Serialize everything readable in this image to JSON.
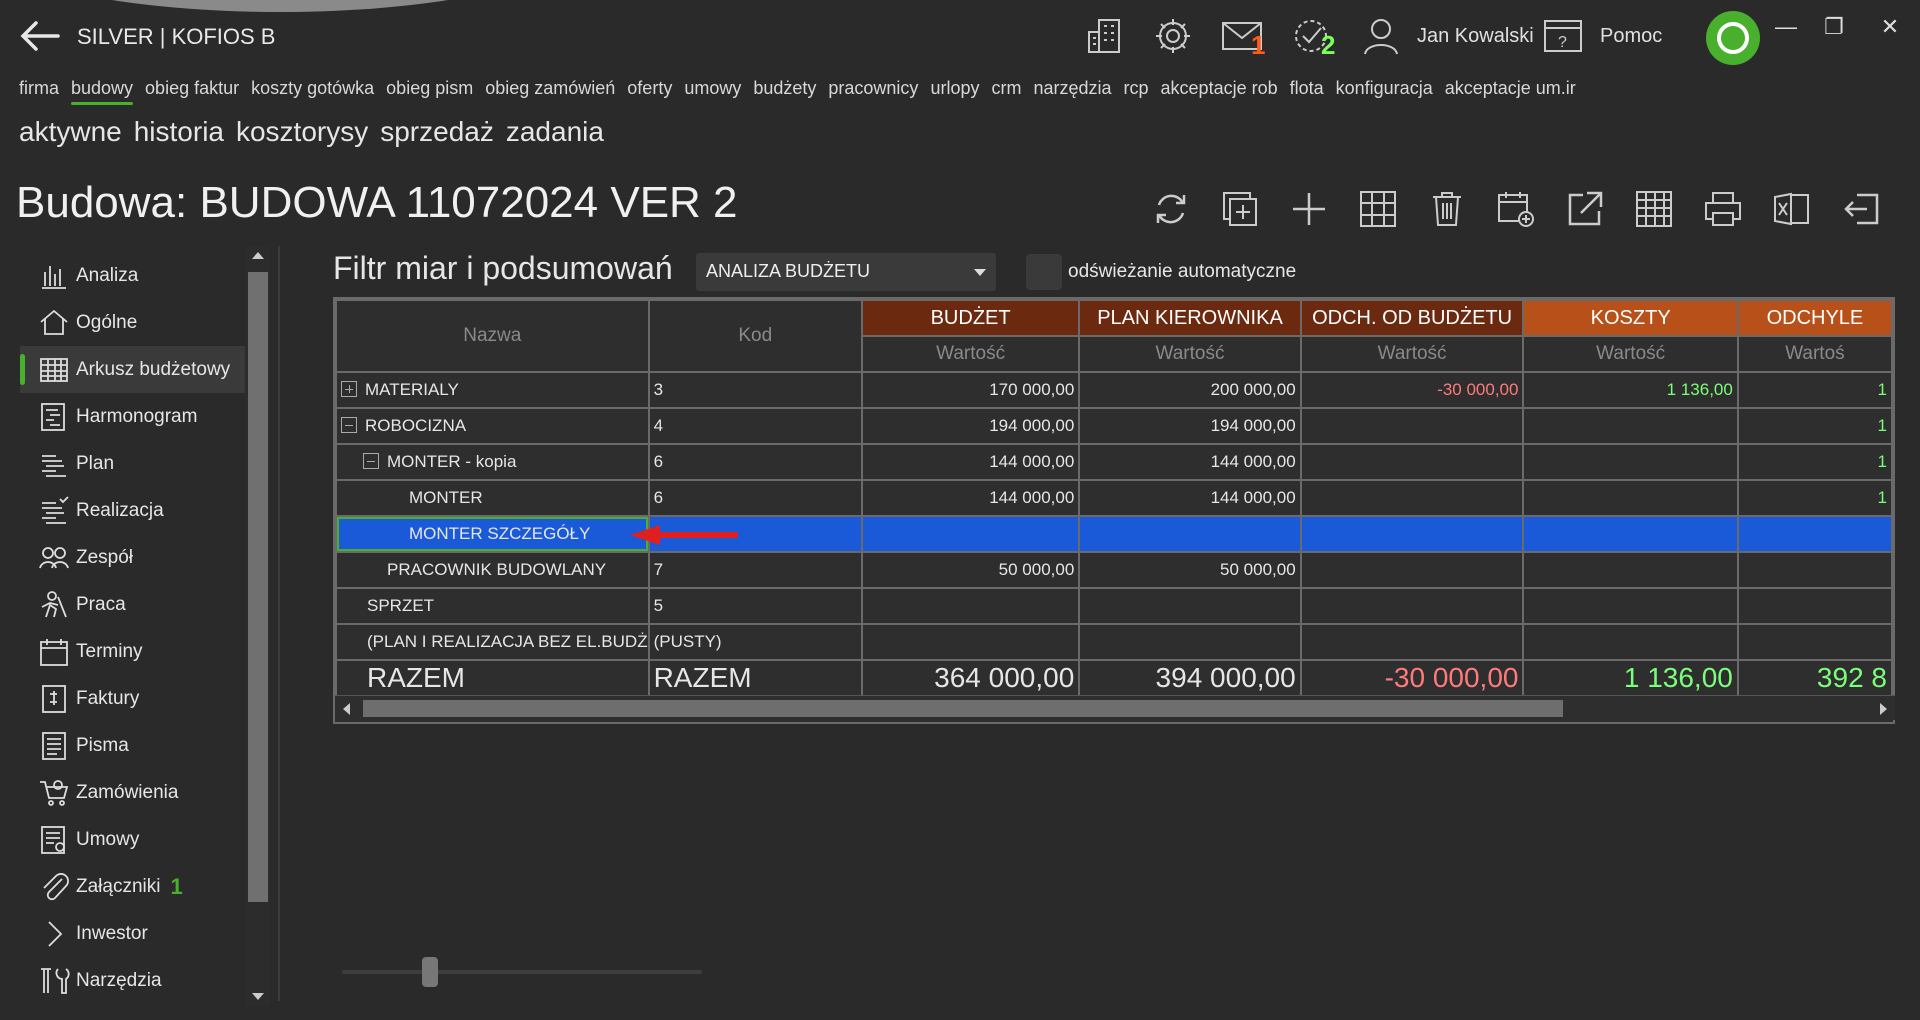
{
  "app": {
    "title": "SILVER | KOFIOS B"
  },
  "header": {
    "mail_badge": "1",
    "tasks_badge": "2",
    "user_name": "Jan Kowalski",
    "help_label": "Pomoc"
  },
  "menu_main": [
    "firma",
    "budowy",
    "obieg faktur",
    "koszty gotówka",
    "obieg pism",
    "obieg zamówień",
    "oferty",
    "umowy",
    "budżety",
    "pracownicy",
    "urlopy",
    "crm",
    "narzędzia",
    "rcp",
    "akceptacje rob",
    "flota",
    "konfiguracja",
    "akceptacje um.ir"
  ],
  "menu_main_active": "budowy",
  "menu_sub": [
    "aktywne",
    "historia",
    "kosztorysy",
    "sprzedaż",
    "zadania"
  ],
  "page_title": "Budowa: BUDOWA 11072024 VER 2",
  "sidebar": [
    {
      "label": "Analiza",
      "icon": "bar-chart-icon"
    },
    {
      "label": "Ogólne",
      "icon": "home-icon"
    },
    {
      "label": "Arkusz budżetowy",
      "icon": "table-icon",
      "active": true
    },
    {
      "label": "Harmonogram",
      "icon": "schedule-icon"
    },
    {
      "label": "Plan",
      "icon": "list-icon"
    },
    {
      "label": "Realizacja",
      "icon": "list-check-icon"
    },
    {
      "label": "Zespół",
      "icon": "team-icon"
    },
    {
      "label": "Praca",
      "icon": "worker-icon"
    },
    {
      "label": "Terminy",
      "icon": "calendar-icon"
    },
    {
      "label": "Faktury",
      "icon": "invoice-icon"
    },
    {
      "label": "Pisma",
      "icon": "document-icon"
    },
    {
      "label": "Zamówienia",
      "icon": "cart-icon"
    },
    {
      "label": "Umowy",
      "icon": "contract-icon"
    },
    {
      "label": "Załączniki",
      "icon": "paperclip-icon",
      "badge": "1"
    },
    {
      "label": "Inwestor",
      "icon": "chevron-right-icon"
    },
    {
      "label": "Narzędzia",
      "icon": "tools-icon"
    }
  ],
  "filter": {
    "label": "Filtr miar i podsumowań",
    "selected": "ANALIZA BUDŻETU",
    "auto_refresh_label": "odświeżanie automatyczne"
  },
  "grid": {
    "col_name": "Nazwa",
    "col_code": "Kod",
    "measure_columns": [
      {
        "title": "BUDŻET",
        "sub": "Wartość",
        "color": "#6b2a10"
      },
      {
        "title": "PLAN KIEROWNIKA",
        "sub": "Wartość",
        "color": "#6b2a10"
      },
      {
        "title": "ODCH. OD BUDŻETU",
        "sub": "Wartość",
        "color": "#6b2a10"
      },
      {
        "title": "KOSZTY",
        "sub": "Wartość",
        "color": "#b8501a"
      },
      {
        "title": "ODCHYLE",
        "sub": "Wartoś",
        "color": "#b8501a"
      }
    ],
    "rows": [
      {
        "name": "MATERIALY",
        "code": "3",
        "indent": 0,
        "toggle": "plus",
        "v": [
          "170 000,00",
          "200 000,00",
          "-30 000,00",
          "1 136,00",
          "1"
        ]
      },
      {
        "name": "ROBOCIZNA",
        "code": "4",
        "indent": 0,
        "toggle": "minus",
        "v": [
          "194 000,00",
          "194 000,00",
          "",
          "",
          "1"
        ]
      },
      {
        "name": "MONTER - kopia",
        "code": "6",
        "indent": 1,
        "toggle": "minus",
        "v": [
          "144 000,00",
          "144 000,00",
          "",
          "",
          "1"
        ]
      },
      {
        "name": "MONTER",
        "code": "6",
        "indent": 2,
        "toggle": "",
        "v": [
          "144 000,00",
          "144 000,00",
          "",
          "",
          "1"
        ]
      },
      {
        "name": "MONTER SZCZEGÓŁY",
        "code": "",
        "indent": 2,
        "toggle": "",
        "selected": true,
        "v": [
          "",
          "",
          "",
          "",
          ""
        ]
      },
      {
        "name": "PRACOWNIK BUDOWLANY",
        "code": "7",
        "indent": 1,
        "toggle": "",
        "v": [
          "50 000,00",
          "50 000,00",
          "",
          "",
          ""
        ]
      },
      {
        "name": "SPRZET",
        "code": "5",
        "indent": 0,
        "toggle": "",
        "v": [
          "",
          "",
          "",
          "",
          ""
        ]
      },
      {
        "name": "(PLAN I REALIZACJA BEZ EL.BUDŻ",
        "code": "(PUSTY)",
        "indent": 0,
        "toggle": "",
        "v": [
          "",
          "",
          "",
          "",
          ""
        ]
      }
    ],
    "total": {
      "name": "RAZEM",
      "code": "RAZEM",
      "v": [
        "364 000,00",
        "394 000,00",
        "-30 000,00",
        "1 136,00",
        "392 8"
      ]
    }
  },
  "colors": {
    "accent": "#48b02c",
    "selection": "#1a5ad8",
    "negative": "#ff7a7a",
    "positive": "#7aff7a"
  }
}
